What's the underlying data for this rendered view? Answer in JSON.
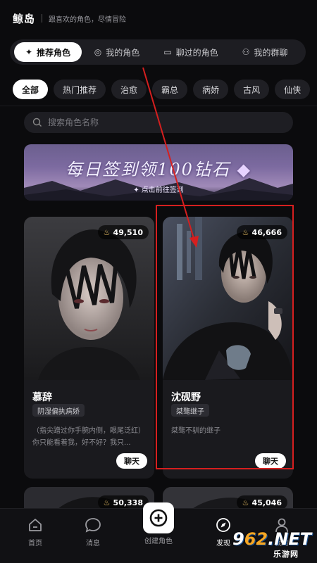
{
  "header": {
    "app_title": "鲸岛",
    "subtitle": "跟喜欢的角色，尽情冒险"
  },
  "tabs": [
    {
      "label": "推荐角色",
      "icon": "sparkle-icon",
      "active": true
    },
    {
      "label": "我的角色",
      "icon": "user-circle-icon",
      "active": false
    },
    {
      "label": "聊过的角色",
      "icon": "chat-bubble-icon",
      "active": false
    },
    {
      "label": "我的群聊",
      "icon": "group-icon",
      "active": false
    }
  ],
  "chips": [
    {
      "label": "全部",
      "active": true
    },
    {
      "label": "热门推荐",
      "active": false
    },
    {
      "label": "治愈",
      "active": false
    },
    {
      "label": "霸总",
      "active": false
    },
    {
      "label": "病娇",
      "active": false
    },
    {
      "label": "古风",
      "active": false
    },
    {
      "label": "仙侠",
      "active": false
    }
  ],
  "search": {
    "placeholder": "搜索角色名称"
  },
  "banner": {
    "title": "每日签到领100钻石",
    "subtitle": "✦ 点击前往签到"
  },
  "cards": [
    {
      "popularity": "49,510",
      "name": "慕辞",
      "tag": "阴湿偏执病娇",
      "description": "（指尖蹭过你手腕内侧，眼尾泛红）你只能看着我，好不好？我只...",
      "chat_label": "聊天"
    },
    {
      "popularity": "46,666",
      "name": "沈砚野",
      "tag": "桀骜继子",
      "description": "桀骜不驯的继子",
      "chat_label": "聊天"
    }
  ],
  "cards_row2": [
    {
      "popularity": "50,338"
    },
    {
      "popularity": "45,046"
    }
  ],
  "bottom_nav": {
    "home": "首页",
    "messages": "消息",
    "create": "创建角色",
    "discover": "发现",
    "profile": "我的"
  },
  "watermark": {
    "main_a": "9",
    "main_b": "62",
    "main_c": ".NET",
    "sub": "乐游网"
  },
  "colors": {
    "annotation_red": "#d61f1f",
    "accent_flame": "#f5c96a",
    "background": "#0b0b0d"
  }
}
